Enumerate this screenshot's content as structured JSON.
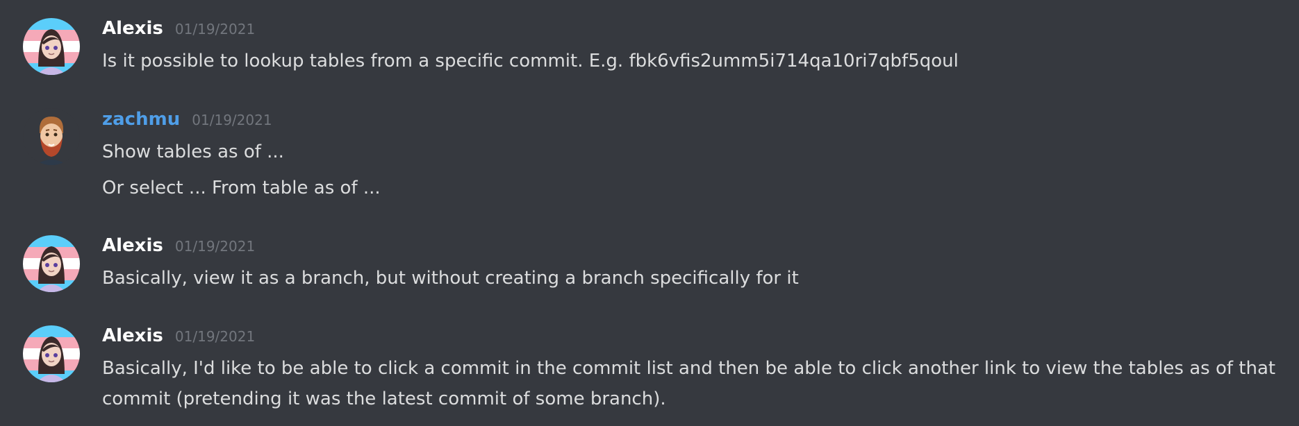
{
  "messages": [
    {
      "author": "Alexis",
      "timestamp": "01/19/2021",
      "avatar_icon": "alexis-avatar-icon",
      "lines": [
        "Is it possible to lookup tables from a specific commit. E.g. fbk6vfis2umm5i714qa10ri7qbf5qoul"
      ]
    },
    {
      "author": "zachmu",
      "timestamp": "01/19/2021",
      "avatar_icon": "zachmu-avatar-icon",
      "author_color": "#4f9ee8",
      "lines": [
        "Show tables as of ...",
        "Or select ... From table as of ..."
      ]
    },
    {
      "author": "Alexis",
      "timestamp": "01/19/2021",
      "avatar_icon": "alexis-avatar-icon",
      "lines": [
        "Basically, view it as a branch, but without creating a branch specifically for it"
      ]
    },
    {
      "author": "Alexis",
      "timestamp": "01/19/2021",
      "avatar_icon": "alexis-avatar-icon",
      "lines": [
        "Basically, I'd like to be able to click a commit in the commit list and then be able to click another link to view the tables as of that commit (pretending it was the latest commit of some branch)."
      ]
    }
  ],
  "colors": {
    "background": "#36393f",
    "author_default": "#ffffff",
    "author_zachmu": "#4f9ee8",
    "timestamp": "#72767d",
    "text": "#dcddde"
  }
}
